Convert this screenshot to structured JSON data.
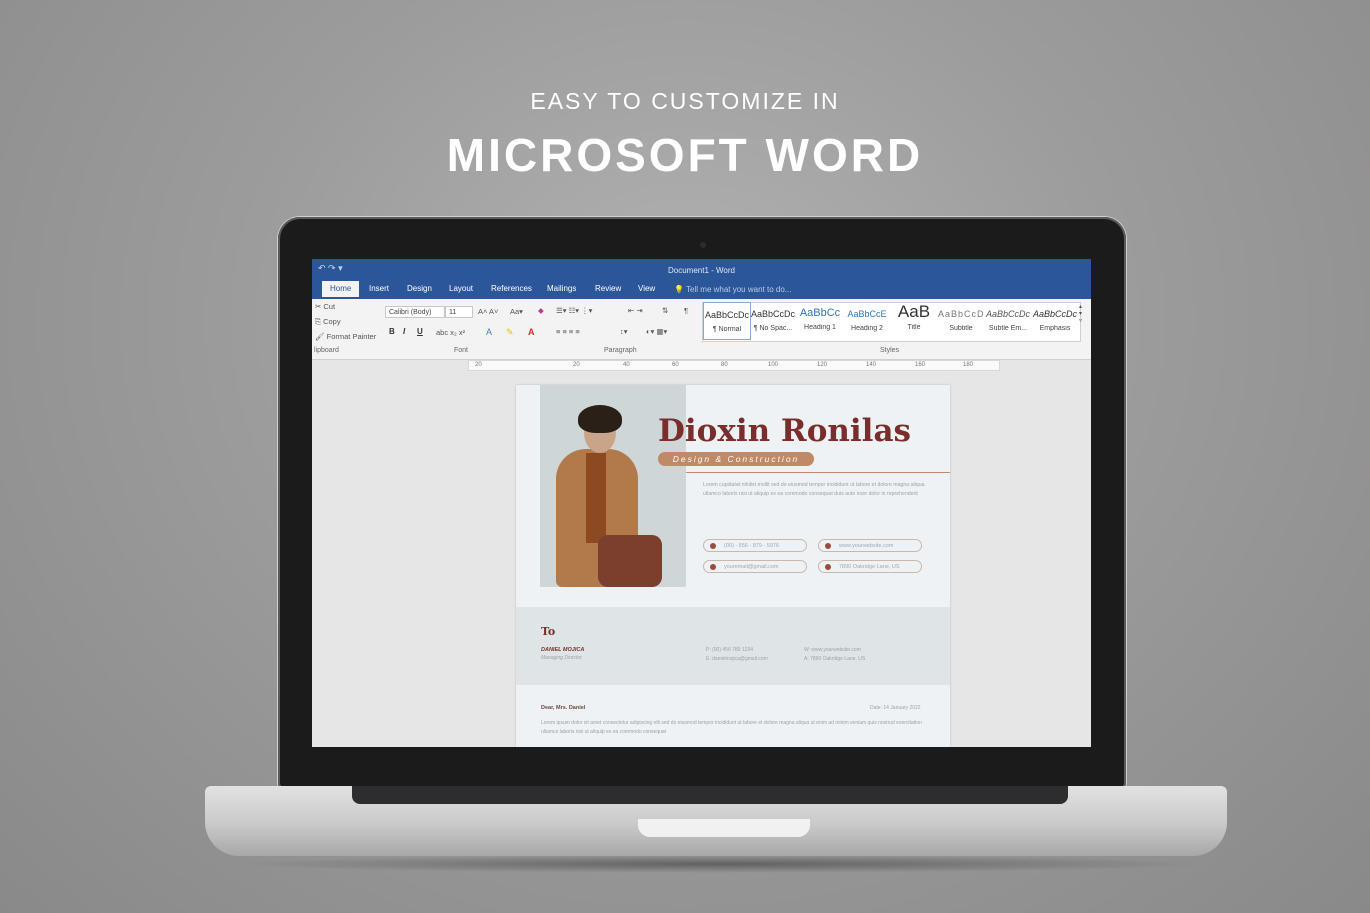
{
  "hero": {
    "subtitle": "EASY TO CUSTOMIZE IN",
    "title": "MICROSOFT WORD"
  },
  "word": {
    "window_title": "Document1 - Word",
    "tabs": [
      "Home",
      "Insert",
      "Design",
      "Layout",
      "References",
      "Mailings",
      "Review",
      "View"
    ],
    "tell_me": "Tell me what you want to do...",
    "clipboard": {
      "cut": "Cut",
      "copy": "Copy",
      "format_painter": "Format Painter",
      "label": "lipboard"
    },
    "font": {
      "family": "Calibri (Body)",
      "size": "11",
      "label": "Font"
    },
    "paragraph": {
      "label": "Paragraph"
    },
    "styles": {
      "label": "Styles",
      "items": [
        {
          "preview": "AaBbCcDc",
          "name": "¶ Normal"
        },
        {
          "preview": "AaBbCcDc",
          "name": "¶ No Spac..."
        },
        {
          "preview": "AaBbCc",
          "name": "Heading 1"
        },
        {
          "preview": "AaBbCcE",
          "name": "Heading 2"
        },
        {
          "preview": "AaB",
          "name": "Title"
        },
        {
          "preview": "AaBbCcD",
          "name": "Subtitle"
        },
        {
          "preview": "AaBbCcDc",
          "name": "Subtle Em..."
        },
        {
          "preview": "AaBbCcDc",
          "name": "Emphasis"
        }
      ]
    },
    "ruler_ticks": [
      "20",
      "20",
      "40",
      "60",
      "80",
      "100",
      "120",
      "140",
      "160",
      "180"
    ]
  },
  "document": {
    "name": "Dioxin Ronilas",
    "role": "Design & Construction",
    "intro": "Lorem cupidatat nihilist mollit sed do eiusmod tempor incididunt ut labore et dolore magna aliqua ullamco laboris nisi ut aliquip ex ea commodo consequat duis aute irure dolor in reprehenderit",
    "contacts": {
      "phone": "(00) - 556 - 879 - 5976",
      "web": "www.yourwebsite.com",
      "email": "youremail@gmail.com",
      "address": "7890 Oakridge Lane, US"
    },
    "to": {
      "title": "To",
      "name": "DANIEL MOJICA",
      "role": "Managing Director",
      "phone": "P: (00) 456 789 1234",
      "email": "E: danielmojica@gmail.com",
      "web": "W: www.yourwebsite.com",
      "address": "A: 7890 Oakridge Lane, US"
    },
    "letter": {
      "greeting": "Dear, Mrs. Daniel",
      "date": "Date: 14 January 2022",
      "body": "Lorem ipsum dolor sit amet consectetur adipiscing elit sed do eiusmod tempor incididunt ut labore et dolore magna aliqua ut enim ad minim veniam quis nostrud exercitation ullamco laboris nisi ut aliquip ex ea commodo consequat"
    }
  }
}
